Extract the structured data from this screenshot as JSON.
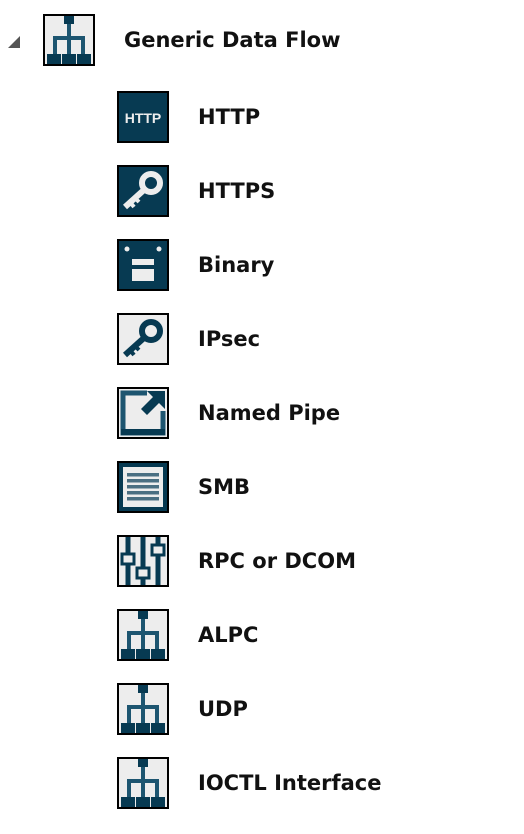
{
  "tree": {
    "parent": {
      "label": "Generic Data Flow",
      "icon": "network-tree-icon",
      "expanded": true
    },
    "children": [
      {
        "label": "HTTP",
        "icon": "http-icon"
      },
      {
        "label": "HTTPS",
        "icon": "key-icon"
      },
      {
        "label": "Binary",
        "icon": "binary-icon"
      },
      {
        "label": "IPsec",
        "icon": "key-icon"
      },
      {
        "label": "Named Pipe",
        "icon": "named-pipe-icon"
      },
      {
        "label": "SMB",
        "icon": "document-lines-icon"
      },
      {
        "label": "RPC or DCOM",
        "icon": "sliders-icon"
      },
      {
        "label": "ALPC",
        "icon": "network-tree-icon"
      },
      {
        "label": "UDP",
        "icon": "network-tree-icon"
      },
      {
        "label": "IOCTL Interface",
        "icon": "network-tree-icon"
      }
    ]
  },
  "colors": {
    "dark": "#073a52",
    "light": "#ededed"
  }
}
